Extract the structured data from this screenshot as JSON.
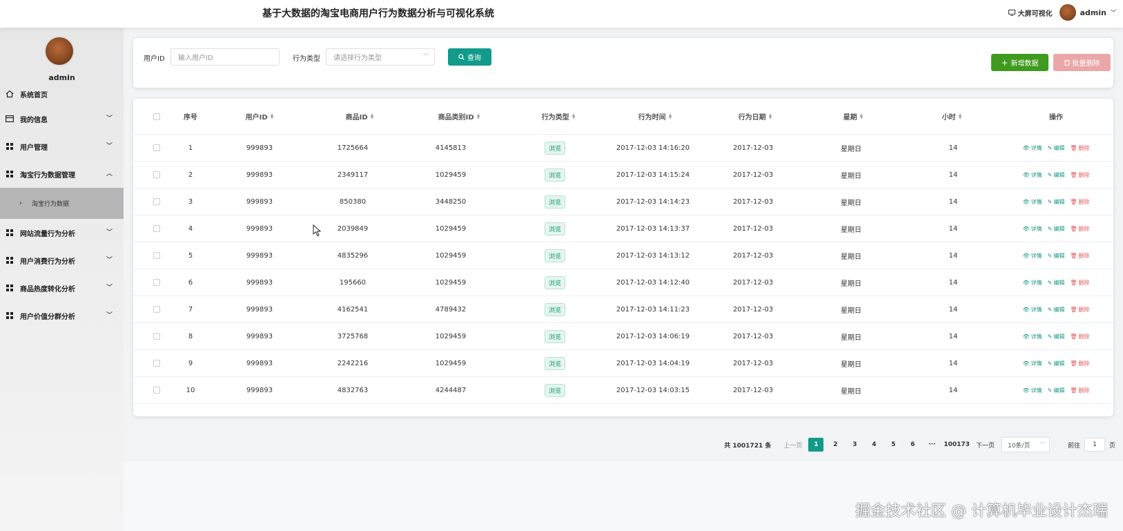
{
  "header": {
    "title": "基于大数据的淘宝电商用户行为数据分析与可视化系统",
    "screen_link": "大屏可视化",
    "user": "admin"
  },
  "sidebar": {
    "username": "admin",
    "items": [
      {
        "label": "系统首页",
        "icon": "home-icon"
      },
      {
        "label": "我的信息",
        "icon": "card-icon"
      },
      {
        "label": "用户管理",
        "icon": "grid-icon"
      },
      {
        "label": "淘宝行为数据管理",
        "icon": "grid-icon"
      },
      {
        "label": "淘宝行为数据",
        "icon": "chevron-right-icon"
      },
      {
        "label": "网站流量行为分析",
        "icon": "grid-icon"
      },
      {
        "label": "用户消费行为分析",
        "icon": "grid-icon"
      },
      {
        "label": "商品热度转化分析",
        "icon": "grid-icon"
      },
      {
        "label": "用户价值分群分析",
        "icon": "grid-icon"
      }
    ]
  },
  "search": {
    "user_id_label": "用户ID",
    "user_id_placeholder": "输入用户ID",
    "behavior_label": "行为类型",
    "behavior_placeholder": "请选择行为类型",
    "query_button": "查询",
    "add_button": "新增数据",
    "batch_delete_button": "批量删除"
  },
  "table": {
    "headers": [
      "序号",
      "用户ID",
      "商品ID",
      "商品类别ID",
      "行为类型",
      "行为时间",
      "行为日期",
      "星期",
      "小时",
      "操作"
    ],
    "actions": {
      "view": "详情",
      "edit": "编辑",
      "delete": "删除"
    },
    "rows": [
      {
        "idx": "1",
        "user_id": "999893",
        "item_id": "1725664",
        "cat_id": "4145813",
        "type": "浏览",
        "time": "2017-12-03 14:16:20",
        "date": "2017-12-03",
        "week": "星期日",
        "hour": "14"
      },
      {
        "idx": "2",
        "user_id": "999893",
        "item_id": "2349117",
        "cat_id": "1029459",
        "type": "浏览",
        "time": "2017-12-03 14:15:24",
        "date": "2017-12-03",
        "week": "星期日",
        "hour": "14"
      },
      {
        "idx": "3",
        "user_id": "999893",
        "item_id": "850380",
        "cat_id": "3448250",
        "type": "浏览",
        "time": "2017-12-03 14:14:23",
        "date": "2017-12-03",
        "week": "星期日",
        "hour": "14"
      },
      {
        "idx": "4",
        "user_id": "999893",
        "item_id": "2039849",
        "cat_id": "1029459",
        "type": "浏览",
        "time": "2017-12-03 14:13:37",
        "date": "2017-12-03",
        "week": "星期日",
        "hour": "14"
      },
      {
        "idx": "5",
        "user_id": "999893",
        "item_id": "4835296",
        "cat_id": "1029459",
        "type": "浏览",
        "time": "2017-12-03 14:13:12",
        "date": "2017-12-03",
        "week": "星期日",
        "hour": "14"
      },
      {
        "idx": "6",
        "user_id": "999893",
        "item_id": "195660",
        "cat_id": "1029459",
        "type": "浏览",
        "time": "2017-12-03 14:12:40",
        "date": "2017-12-03",
        "week": "星期日",
        "hour": "14"
      },
      {
        "idx": "7",
        "user_id": "999893",
        "item_id": "4162541",
        "cat_id": "4789432",
        "type": "浏览",
        "time": "2017-12-03 14:11:23",
        "date": "2017-12-03",
        "week": "星期日",
        "hour": "14"
      },
      {
        "idx": "8",
        "user_id": "999893",
        "item_id": "3725768",
        "cat_id": "1029459",
        "type": "浏览",
        "time": "2017-12-03 14:06:19",
        "date": "2017-12-03",
        "week": "星期日",
        "hour": "14"
      },
      {
        "idx": "9",
        "user_id": "999893",
        "item_id": "2242216",
        "cat_id": "1029459",
        "type": "浏览",
        "time": "2017-12-03 14:04:19",
        "date": "2017-12-03",
        "week": "星期日",
        "hour": "14"
      },
      {
        "idx": "10",
        "user_id": "999893",
        "item_id": "4832763",
        "cat_id": "4244487",
        "type": "浏览",
        "time": "2017-12-03 14:03:15",
        "date": "2017-12-03",
        "week": "星期日",
        "hour": "14"
      }
    ]
  },
  "pagination": {
    "total": "共 1001721 条",
    "prev": "上一页",
    "pages": [
      "1",
      "2",
      "3",
      "4",
      "5",
      "6",
      "···",
      "100173"
    ],
    "next": "下一页",
    "page_size": "10条/页",
    "goto_label": "前往",
    "goto_value": "1",
    "goto_suffix": "页"
  },
  "watermark": "掘金技术社区 @ 计算机毕业设计杰瑞",
  "colors": {
    "accent": "#129a8a",
    "add": "#3f9a1e",
    "danger": "#e9a9a9"
  }
}
